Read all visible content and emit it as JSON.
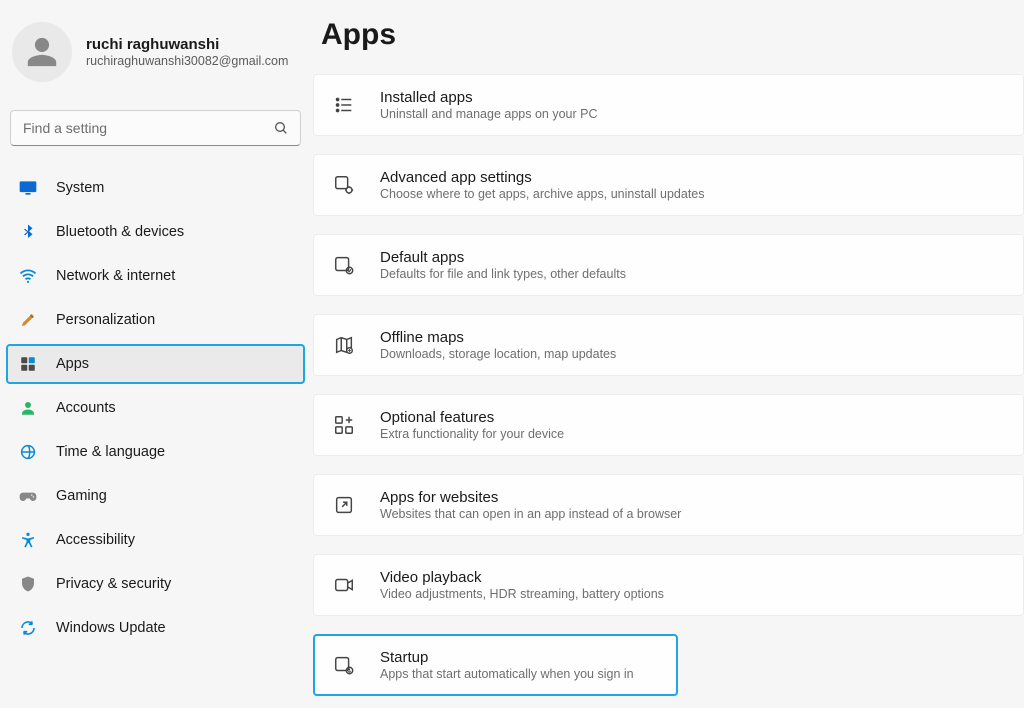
{
  "user": {
    "name": "ruchi raghuwanshi",
    "email": "ruchiraghuwanshi30082@gmail.com"
  },
  "search": {
    "placeholder": "Find a setting"
  },
  "nav": {
    "items": [
      {
        "label": "System"
      },
      {
        "label": "Bluetooth & devices"
      },
      {
        "label": "Network & internet"
      },
      {
        "label": "Personalization"
      },
      {
        "label": "Apps"
      },
      {
        "label": "Accounts"
      },
      {
        "label": "Time & language"
      },
      {
        "label": "Gaming"
      },
      {
        "label": "Accessibility"
      },
      {
        "label": "Privacy & security"
      },
      {
        "label": "Windows Update"
      }
    ]
  },
  "page": {
    "title": "Apps",
    "cards": [
      {
        "title": "Installed apps",
        "desc": "Uninstall and manage apps on your PC"
      },
      {
        "title": "Advanced app settings",
        "desc": "Choose where to get apps, archive apps, uninstall updates"
      },
      {
        "title": "Default apps",
        "desc": "Defaults for file and link types, other defaults"
      },
      {
        "title": "Offline maps",
        "desc": "Downloads, storage location, map updates"
      },
      {
        "title": "Optional features",
        "desc": "Extra functionality for your device"
      },
      {
        "title": "Apps for websites",
        "desc": "Websites that can open in an app instead of a browser"
      },
      {
        "title": "Video playback",
        "desc": "Video adjustments, HDR streaming, battery options"
      },
      {
        "title": "Startup",
        "desc": "Apps that start automatically when you sign in"
      }
    ]
  }
}
